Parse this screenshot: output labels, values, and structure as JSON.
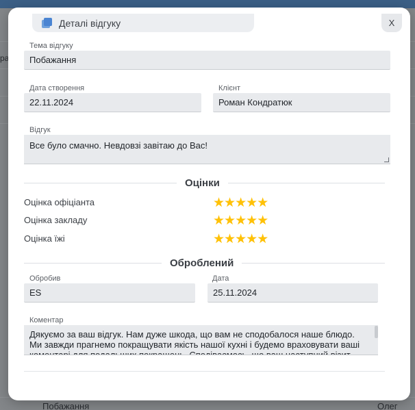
{
  "modal": {
    "title": "Деталі відгуку",
    "close_label": "X"
  },
  "form": {
    "topic": {
      "label": "Тема відгуку",
      "value": "Побажання"
    },
    "created": {
      "label": "Дата створення",
      "value": "22.11.2024"
    },
    "client": {
      "label": "Клієнт",
      "value": "Роман Кондратюк"
    },
    "review": {
      "label": "Відгук",
      "value": "Все було смачно. Невдовзі завітаю до Вас!"
    }
  },
  "ratings": {
    "title": "Оцінки",
    "items": [
      {
        "label": "Оцінка офіціанта",
        "stars": "★★★★★",
        "value": 5,
        "max": 5
      },
      {
        "label": "Оцінка закладу",
        "stars": "★★★★★",
        "value": 5,
        "max": 5
      },
      {
        "label": "Оцінка їжі",
        "stars": "★★★★★",
        "value": 5,
        "max": 5
      }
    ]
  },
  "processed": {
    "title": "Оброблений",
    "by": {
      "label": "Обробив",
      "value": "ES"
    },
    "date": {
      "label": "Дата",
      "value": "25.11.2024"
    },
    "comment": {
      "label": "Коментар",
      "line1": "Дякуємо за ваш відгук. Нам дуже шкода, що вам не сподобалося наше блюдо.",
      "line2": "Ми завжди прагнемо покращувати якість нашої кухні і будемо враховувати ваші",
      "line3": "коментарі для подальших покращень. Сподіваємось, що ваш наступний візит"
    }
  },
  "background": {
    "left_fragment": "ра",
    "bottom_left": "Побажання",
    "bottom_right": "Олег"
  },
  "colors": {
    "accent": "#4a84d2",
    "star": "#ffc107"
  }
}
